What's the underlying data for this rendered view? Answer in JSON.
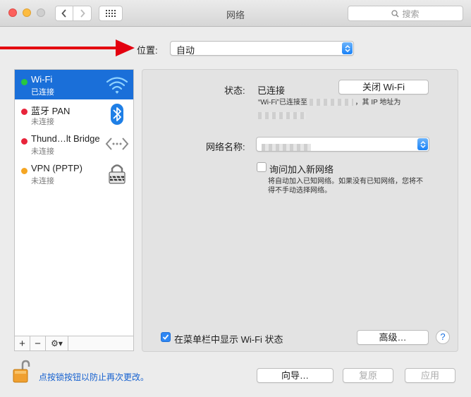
{
  "window": {
    "title": "网络"
  },
  "toolbar": {
    "search_placeholder": "搜索"
  },
  "location": {
    "label": "位置:",
    "value": "自动"
  },
  "services": [
    {
      "name": "Wi-Fi",
      "status": "已连接",
      "status_color": "#28c840",
      "icon": "wifi-icon",
      "selected": true
    },
    {
      "name": "蓝牙 PAN",
      "status": "未连接",
      "status_color": "#e8243b",
      "icon": "bluetooth-icon",
      "selected": false
    },
    {
      "name": "Thund…lt Bridge",
      "status": "未连接",
      "status_color": "#e8243b",
      "icon": "ethernet-icon",
      "selected": false
    },
    {
      "name": "VPN (PPTP)",
      "status": "未连接",
      "status_color": "#f5a623",
      "icon": "lock-icon",
      "selected": false
    }
  ],
  "sidebar_toolbar": {
    "add": "+",
    "remove": "−",
    "gear": "⚙▾"
  },
  "detail": {
    "status_label": "状态:",
    "status_value": "已连接",
    "toggle_button": "关闭 Wi-Fi",
    "status_desc_prefix": "“Wi-Fi”已连接至",
    "status_desc_suffix": "，其 IP 地址为",
    "network_name_label": "网络名称:",
    "ask_join_label": "询问加入新网络",
    "ask_join_desc_1": "将自动加入已知网络。如果没有已知网络，您将不",
    "ask_join_desc_2": "得不手动选择网络。",
    "show_menubar_label": "在菜单栏中显示 Wi-Fi 状态",
    "advanced_button": "高级…",
    "help": "?"
  },
  "footer": {
    "lock_text": "点按锁按钮以防止再次更改。",
    "assistant_button": "向导…",
    "revert_button": "复原",
    "apply_button": "应用"
  }
}
